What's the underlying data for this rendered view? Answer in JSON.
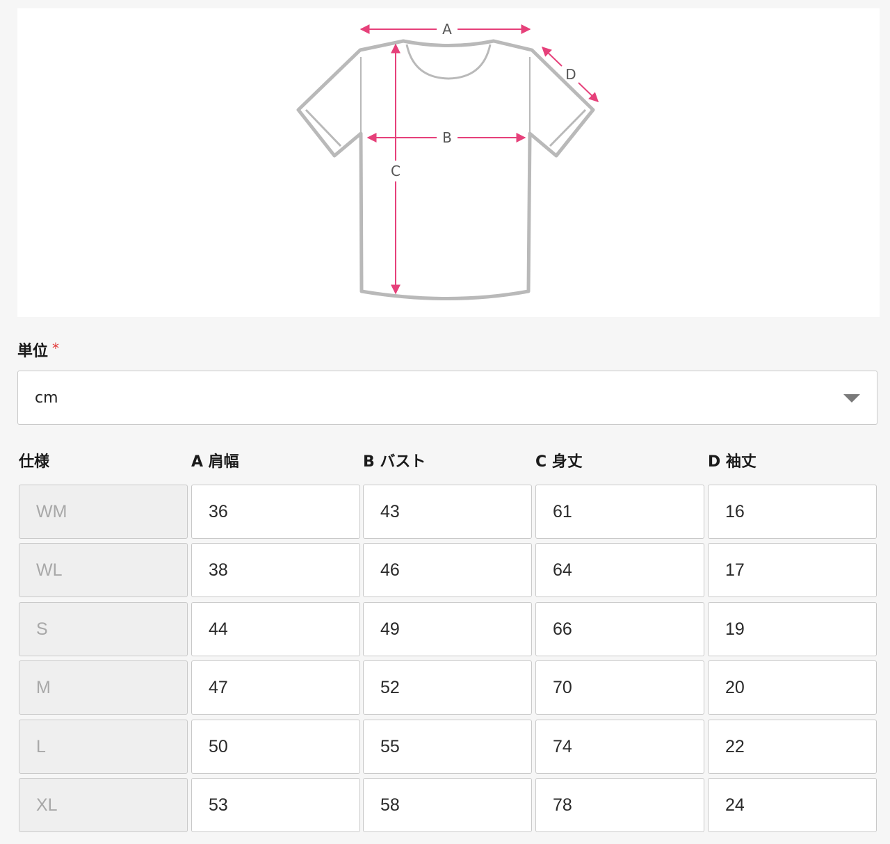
{
  "diagram": {
    "labels": {
      "a": "A",
      "b": "B",
      "c": "C",
      "d": "D"
    },
    "colors": {
      "outline": "#b9b9b9",
      "arrow": "#e6407a"
    }
  },
  "unit_field": {
    "label": "単位",
    "required_mark": "*",
    "value": "cm",
    "icon": "chevron-down-icon"
  },
  "table": {
    "headers": [
      "仕様",
      "A 肩幅",
      "B バスト",
      "C 身丈",
      "D 袖丈"
    ],
    "rows": [
      [
        "WM",
        "36",
        "43",
        "61",
        "16"
      ],
      [
        "WL",
        "38",
        "46",
        "64",
        "17"
      ],
      [
        "S",
        "44",
        "49",
        "66",
        "19"
      ],
      [
        "M",
        "47",
        "52",
        "70",
        "20"
      ],
      [
        "L",
        "50",
        "55",
        "74",
        "22"
      ],
      [
        "XL",
        "53",
        "58",
        "78",
        "24"
      ]
    ]
  }
}
